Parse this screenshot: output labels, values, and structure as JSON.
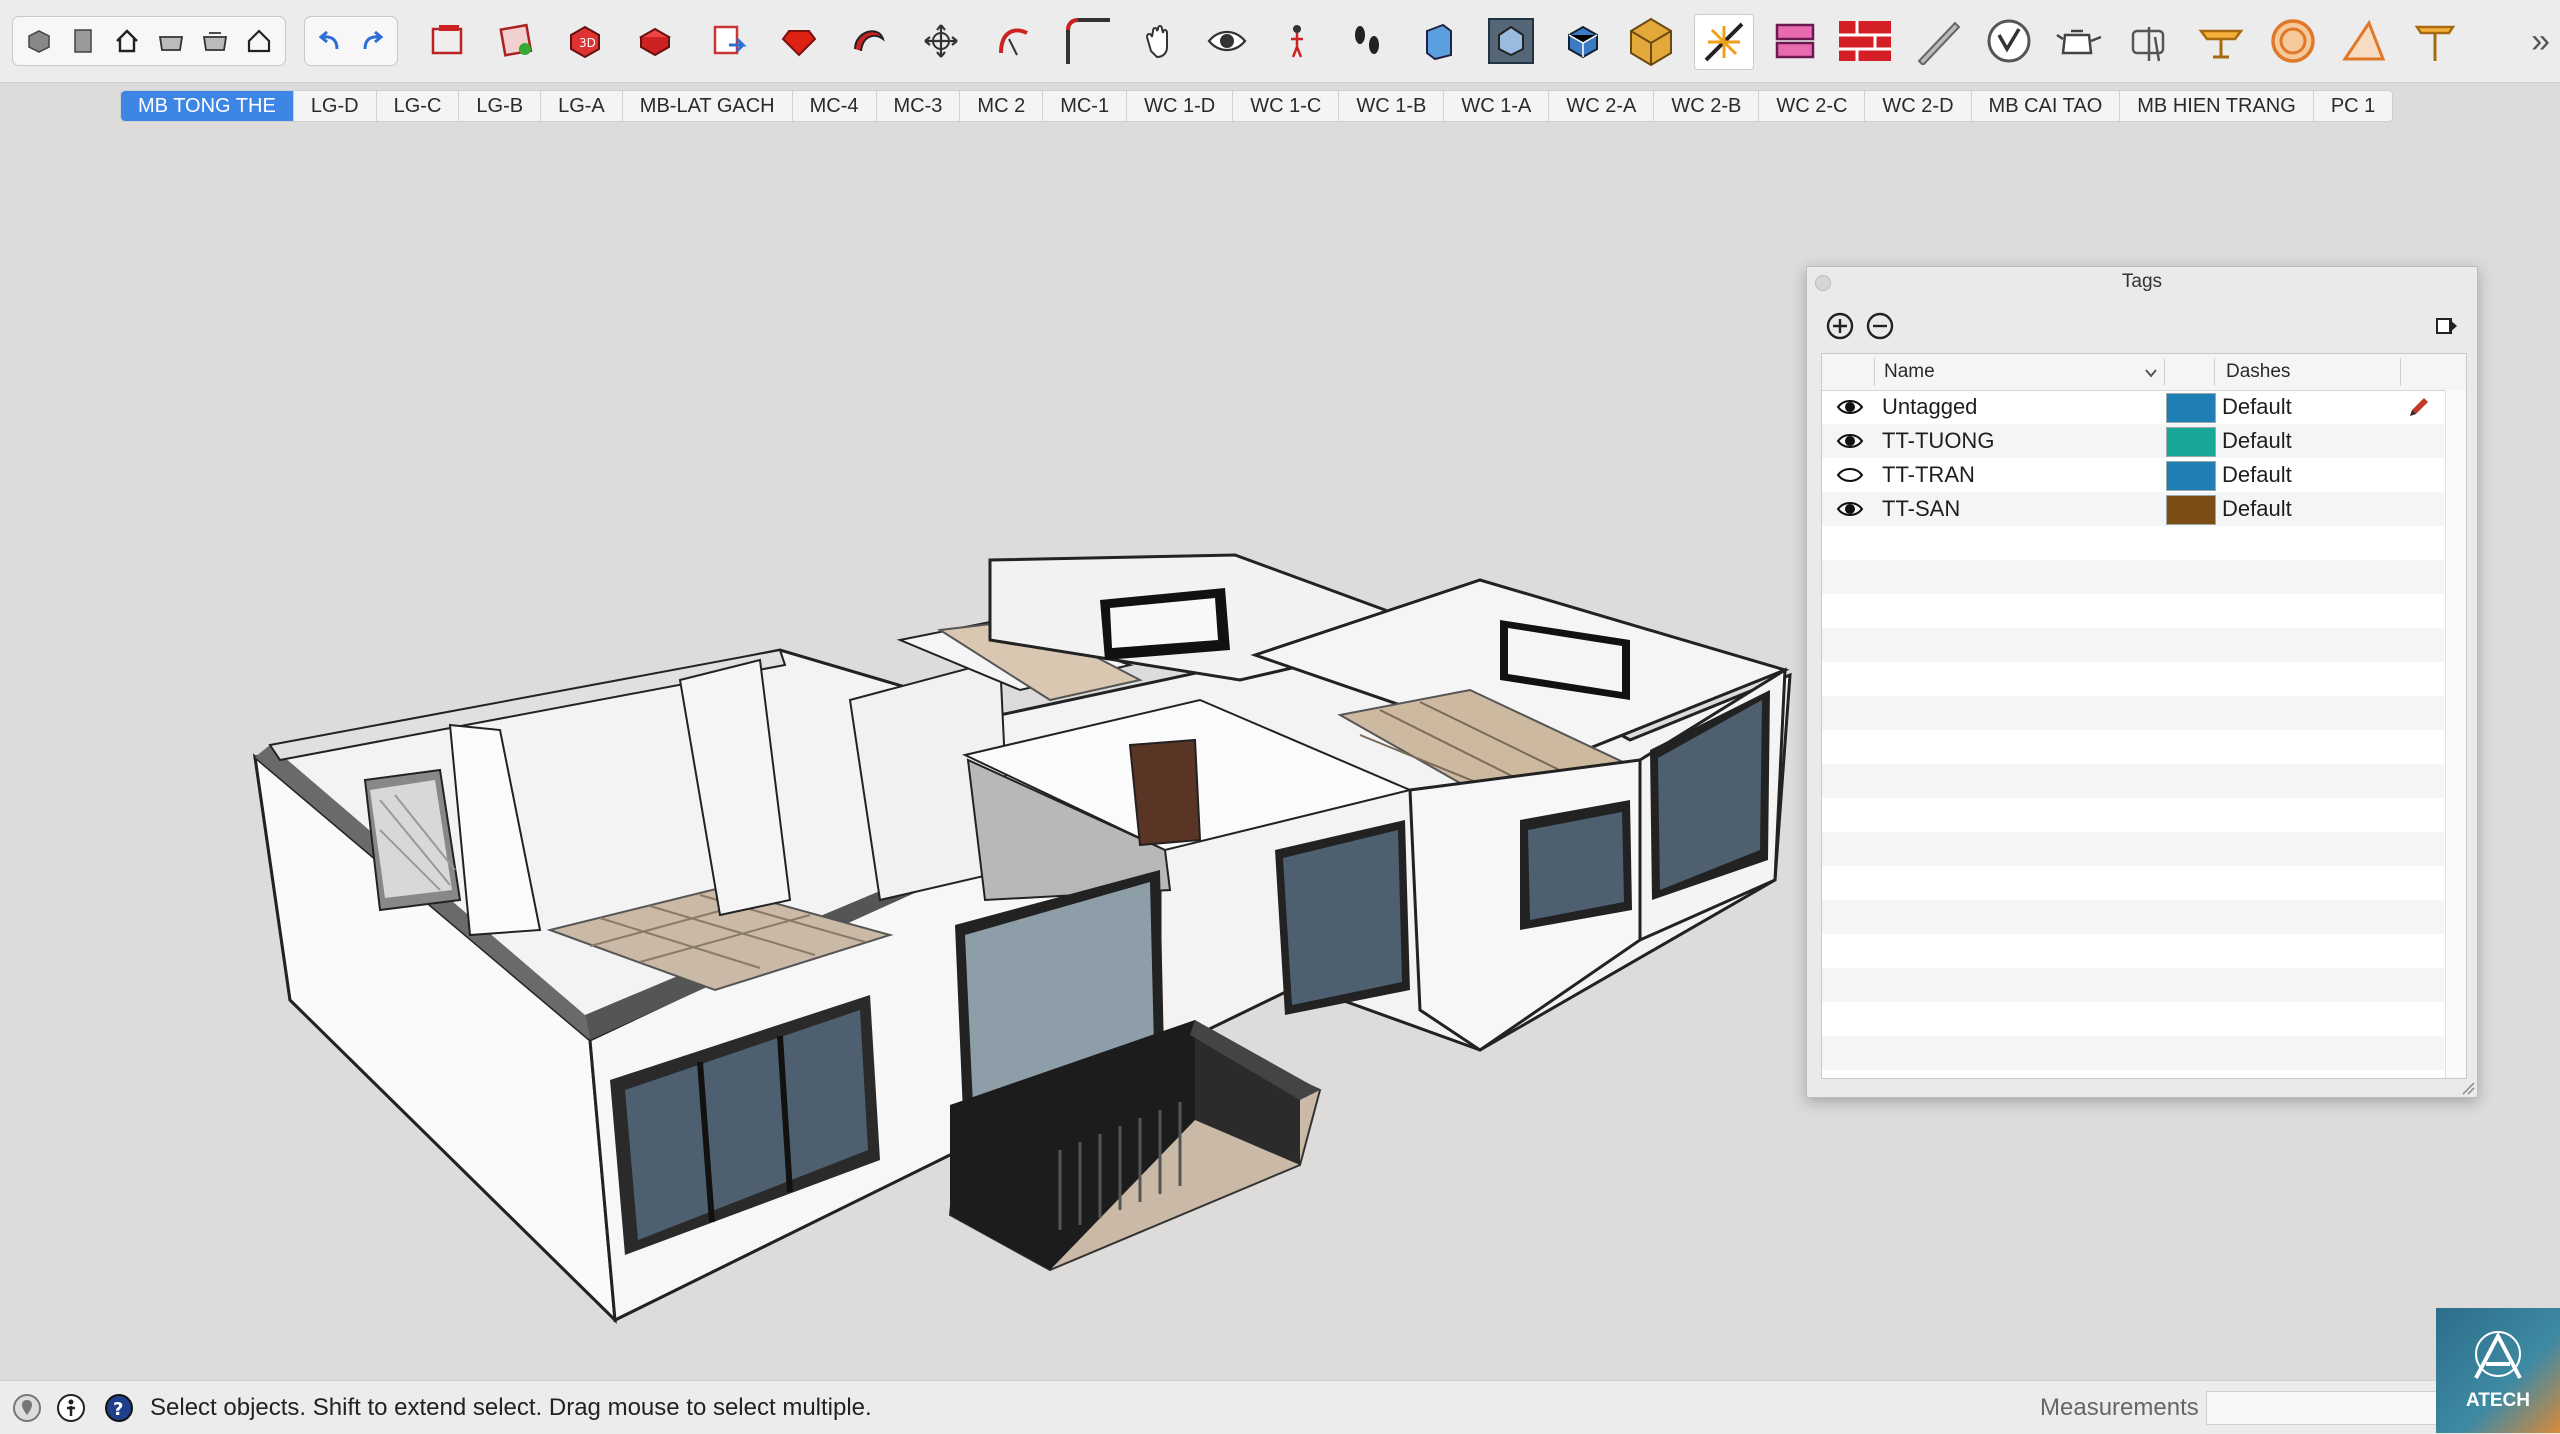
{
  "toolbar": {
    "icons": [
      "components-icon",
      "3d-warehouse-icon",
      "home-icon",
      "open-icon",
      "save-icon",
      "house-icon",
      "undo-icon",
      "redo-icon",
      "plugin-icon-1",
      "plugin-icon-2",
      "plugin-icon-3",
      "plugin-icon-4",
      "plugin-icon-5",
      "ruby-icon",
      "sketch-icon",
      "move-icon",
      "curve-icon",
      "corner-icon",
      "pan-icon",
      "look-around-icon",
      "walk-icon",
      "footprints-icon",
      "section-icon",
      "section-fill-icon",
      "solid-icon",
      "box-icon",
      "explode-icon",
      "layers-icon",
      "brick-icon",
      "tape-icon",
      "vray-icon",
      "teapot-icon",
      "hand-icon",
      "table-icon",
      "circle-icon",
      "protractor-icon",
      "stool-icon"
    ]
  },
  "scenes": {
    "active": "MB TONG THE",
    "tabs": [
      "MB TONG THE",
      "LG-D",
      "LG-C",
      "LG-B",
      "LG-A",
      "MB-LAT GACH",
      "MC-4",
      "MC-3",
      "MC 2",
      "MC-1",
      "WC 1-D",
      "WC 1-C",
      "WC 1-B",
      "WC 1-A",
      "WC 2-A",
      "WC 2-B",
      "WC 2-C",
      "WC 2-D",
      "MB CAI TAO",
      "MB HIEN TRANG",
      "PC 1"
    ]
  },
  "tags_panel": {
    "title": "Tags",
    "col_name": "Name",
    "col_dashes": "Dashes",
    "rows": [
      {
        "name": "Untagged",
        "visible": true,
        "color": "#1f7fb4",
        "dashes": "Default"
      },
      {
        "name": "TT-TUONG",
        "visible": true,
        "color": "#18a89a",
        "dashes": "Default"
      },
      {
        "name": "TT-TRAN",
        "visible": false,
        "color": "#1f7fb4",
        "dashes": "Default"
      },
      {
        "name": "TT-SAN",
        "visible": true,
        "color": "#7a4e14",
        "dashes": "Default"
      }
    ]
  },
  "status": {
    "message": "Select objects. Shift to extend select. Drag mouse to select multiple.",
    "measurements_label": "Measurements",
    "measurements_value": ""
  },
  "logo": {
    "text": "ATECH"
  },
  "colors": {
    "accent": "#3d86e6",
    "background": "#dddcda"
  }
}
